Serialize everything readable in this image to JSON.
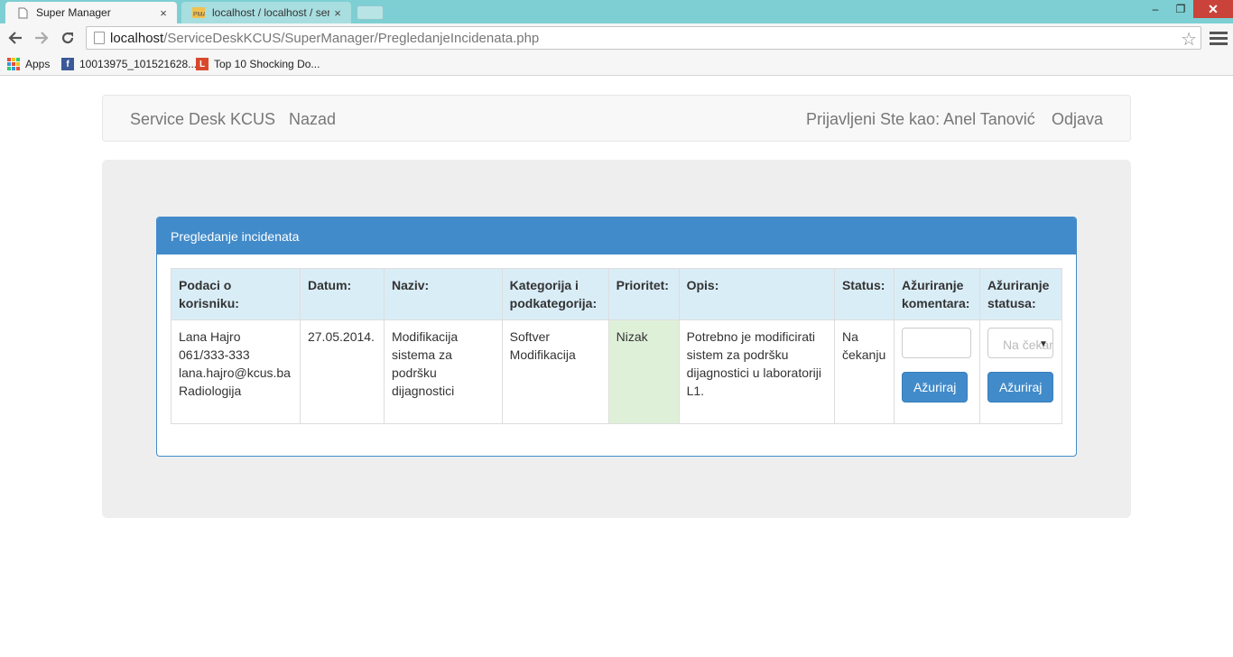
{
  "browser": {
    "tabs": [
      {
        "title": "Super Manager",
        "close": "×"
      },
      {
        "title": "localhost / localhost / serv",
        "close": "×"
      }
    ],
    "address": {
      "host": "localhost",
      "path": "/ServiceDeskKCUS/SuperManager/PregledanjeIncidenata.php"
    },
    "bookmarks": [
      "Apps",
      "10013975_101521628...",
      "Top 10 Shocking Do..."
    ],
    "window_buttons": {
      "minimize": "–",
      "restore": "❐",
      "close": "✕"
    }
  },
  "navbar": {
    "brand": "Service Desk KCUS",
    "back": "Nazad",
    "logged_in": "Prijavljeni Ste kao: Anel Tanović",
    "logout": "Odjava"
  },
  "panel": {
    "title": "Pregledanje incidenata"
  },
  "table": {
    "headers": [
      "Podaci o korisniku:",
      "Datum:",
      "Naziv:",
      "Kategorija i podkategorija:",
      "Prioritet:",
      "Opis:",
      "Status:",
      "Ažuriranje komentara:",
      "Ažuriranje statusa:"
    ],
    "row": {
      "user": "Lana Hajro\n061/333-333\nlana.hajro@kcus.ba\nRadiologija",
      "date": "27.05.2014.",
      "name": "Modifikacija sistema za podršku dijagnostici",
      "category": "Softver Modifikacija",
      "priority": "Nizak",
      "description": "Potrebno je modificirati sistem za podršku dijagnostici u laboratoriji L1.",
      "status": "Na čekanju",
      "comment_button": "Ažuriraj",
      "status_select": "Na čekanju",
      "status_button": "Ažuriraj"
    }
  },
  "colors": {
    "primary": "#428bca",
    "header_bg": "#d9edf7",
    "success_bg": "#dff0d8",
    "jumbotron": "#eeeeee"
  }
}
